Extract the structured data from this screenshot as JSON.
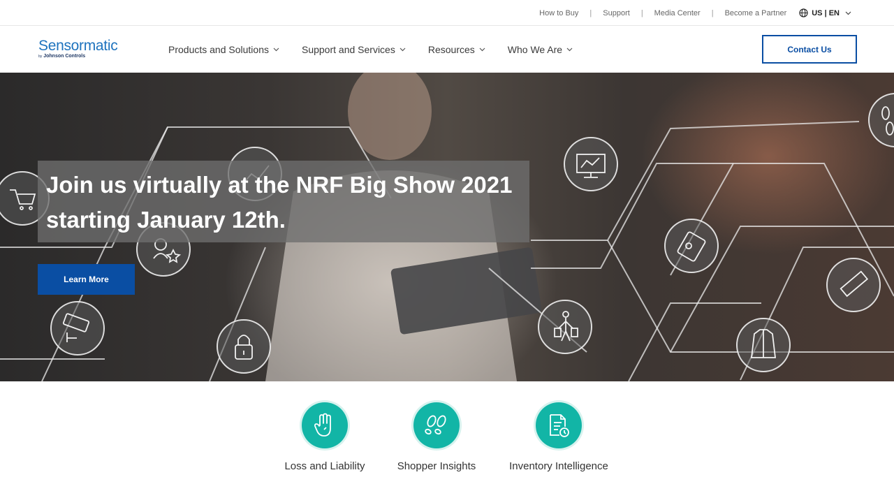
{
  "utility": {
    "links": [
      "How to Buy",
      "Support",
      "Media Center",
      "Become a Partner"
    ],
    "language": "US | EN",
    "language_icon": "globe-icon"
  },
  "nav": {
    "logo_text": "Sensormatic",
    "logo_sub_by": "by",
    "logo_sub": "Johnson Controls",
    "menu": [
      {
        "label": "Products and Solutions"
      },
      {
        "label": "Support and Services"
      },
      {
        "label": "Resources"
      },
      {
        "label": "Who We Are"
      }
    ],
    "contact_label": "Contact Us"
  },
  "hero": {
    "headline_line1": "Join us virtually at the NRF Big Show 2021",
    "headline_line2": "starting January 12th.",
    "cta_label": "Learn More",
    "icons": [
      "shopping-cart-icon",
      "chart-icon",
      "monitor-chart-icon",
      "location-star-icon",
      "card-reader-icon",
      "camera-icon",
      "lock-icon",
      "shopper-icon",
      "tag-icon",
      "jacket-icon",
      "footprints-icon"
    ]
  },
  "categories": [
    {
      "label": "Loss and Liability",
      "icon": "hand-icon"
    },
    {
      "label": "Shopper Insights",
      "icon": "footprints-icon"
    },
    {
      "label": "Inventory Intelligence",
      "icon": "document-tag-icon"
    }
  ],
  "colors": {
    "brand_blue": "#0a4ea3",
    "logo_blue": "#1e73be",
    "teal": "#12b5a6"
  }
}
